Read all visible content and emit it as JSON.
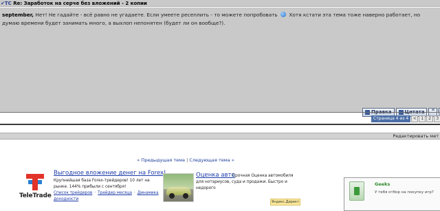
{
  "post": {
    "marker": "✔TC",
    "title": "Re: Заработок на серче без вложений - 2 копии",
    "author": "september",
    "text_before": "Нет! Не гадайте - всё равно не угадаете. Если умеете ресеплить - то можете попробовать",
    "smile_icon": "smile-icon",
    "text_after": "Хотя кстати эта тема тоже наверно работает, но думаю времени будет занимать много, а выхлоп непонятен (будет ли он вообще?)."
  },
  "post_buttons": {
    "edit_label": "Правка",
    "quote_label": "Цитата",
    "multiquote_label": "\""
  },
  "pagination": {
    "label": "Страница 4 из 4",
    "pages": [
      "<",
      "1",
      "2",
      "3",
      "4"
    ],
    "current": "4"
  },
  "moderation": {
    "label": "Редактировать мет"
  },
  "topic_nav": {
    "prev": "« Предыдущая тема",
    "separator": "|",
    "next": "Следующая тема »"
  },
  "ads": {
    "teletrade": {
      "logo_text": "TeleTrade",
      "headline": "Выгодное вложение денег на Forex!",
      "description": "Крупнейшая база Forex-трейдеров! 10 лет на рынке. 144% прибыли с сентября!",
      "links": [
        "Список трейдеров",
        "Трейдер месяца",
        "Динамика доходности"
      ]
    },
    "auto": {
      "headline": "Оценка авто",
      "description": "Срочная Оценка автомобиля для нотариусов, суда и продажи. Быстро и недорого",
      "badge": "Яндекс.Директ"
    },
    "side": {
      "headline": "Geeks",
      "description": "У тебя отбор на покупку игр?"
    }
  },
  "colors": {
    "post_background": "#c9c9c9",
    "link_blue": "#1a3aa8",
    "pager_label": "#4b6ea6"
  }
}
